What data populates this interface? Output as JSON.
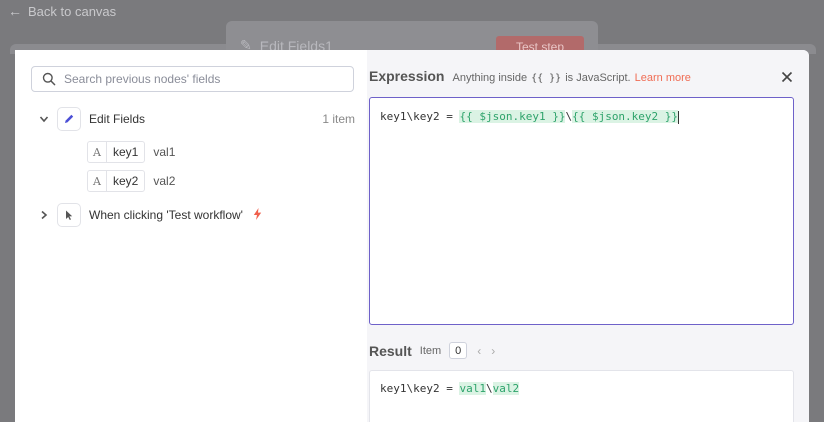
{
  "background": {
    "back_link": "Back to canvas",
    "panel_title": "Edit Fields1",
    "panel_button": "Test step"
  },
  "left_panel": {
    "search_placeholder": "Search previous nodes' fields",
    "nodes": [
      {
        "name": "Edit Fields",
        "count": "1 item",
        "expanded": true,
        "icon": "pencil-icon",
        "fields": [
          {
            "type": "A",
            "name": "key1",
            "value": "val1"
          },
          {
            "type": "A",
            "name": "key2",
            "value": "val2"
          }
        ]
      },
      {
        "name": "When clicking 'Test workflow'",
        "expanded": false,
        "icon": "cursor-icon",
        "trigger_icon": "bolt-icon"
      }
    ]
  },
  "expression": {
    "title": "Expression",
    "hint_prefix": "Anything inside",
    "hint_code": "{{ }}",
    "hint_suffix": "is JavaScript.",
    "learn_more": "Learn more",
    "code": {
      "prefix": "key1\\key2 = ",
      "expr1": "{{ $json.key1 }}",
      "separator": "\\",
      "expr2": "{{ $json.key2 }}"
    }
  },
  "result": {
    "title": "Result",
    "item_label": "Item",
    "item_index": "0",
    "output": {
      "prefix": "key1\\key2 = ",
      "val1": "val1",
      "separator": "\\",
      "val2": "val2"
    }
  },
  "colors": {
    "accent": "#6e61c9",
    "link": "#f06d55",
    "highlight_bg": "#dbf3e4",
    "highlight_text": "#2ea36b"
  }
}
